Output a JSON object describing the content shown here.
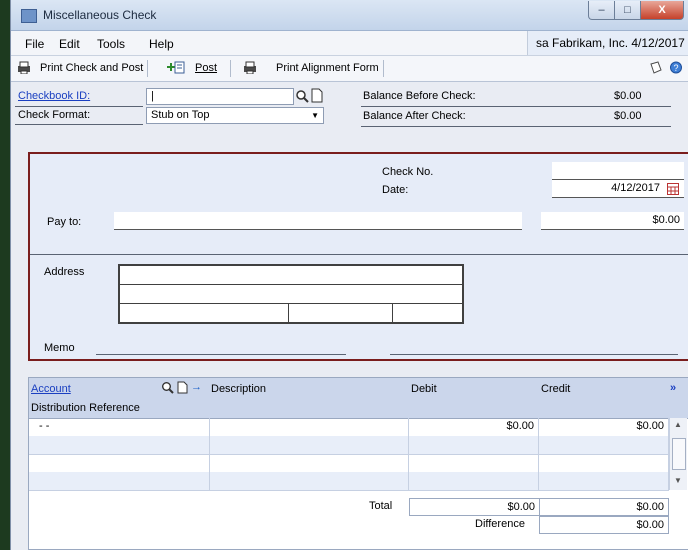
{
  "window": {
    "title": "Miscellaneous Check",
    "controls": {
      "minimize": "–",
      "maximize": "□",
      "close": "X"
    }
  },
  "menu": {
    "items": [
      "File",
      "Edit",
      "Tools",
      "Help"
    ]
  },
  "company_bar": "sa  Fabrikam, Inc.  4/12/2017",
  "toolbar": {
    "print_check_post": "Print Check and Post",
    "post": "Post",
    "print_alignment": "Print Alignment Form"
  },
  "header": {
    "checkbook_id_label": "Checkbook ID:",
    "checkbook_id_value": "|",
    "check_format_label": "Check Format:",
    "check_format_value": "Stub on Top",
    "balance_before_label": "Balance Before Check:",
    "balance_before_value": "$0.00",
    "balance_after_label": "Balance After Check:",
    "balance_after_value": "$0.00"
  },
  "check": {
    "check_no_label": "Check No.",
    "check_no_value": "",
    "date_label": "Date:",
    "date_value": "4/12/2017",
    "pay_to_label": "Pay to:",
    "pay_to_value": "",
    "amount_value": "$0.00",
    "address_label": "Address",
    "memo_label": "Memo"
  },
  "grid": {
    "col_account": "Account",
    "col_description": "Description",
    "col_debit": "Debit",
    "col_credit": "Credit",
    "sub_header": "Distribution Reference",
    "rows": [
      {
        "account": "-        -",
        "description": "",
        "debit": "$0.00",
        "credit": "$0.00"
      },
      {
        "account": "",
        "description": "",
        "debit": "",
        "credit": ""
      },
      {
        "account": "",
        "description": "",
        "debit": "",
        "credit": ""
      },
      {
        "account": "",
        "description": "",
        "debit": "",
        "credit": ""
      }
    ],
    "total_label": "Total",
    "total_debit": "$0.00",
    "total_credit": "$0.00",
    "difference_label": "Difference",
    "difference_value": "$0.00"
  },
  "colors": {
    "accent_border": "#7a1d1d",
    "link": "#1a3fc1",
    "grid_header": "#cbd6eb"
  }
}
